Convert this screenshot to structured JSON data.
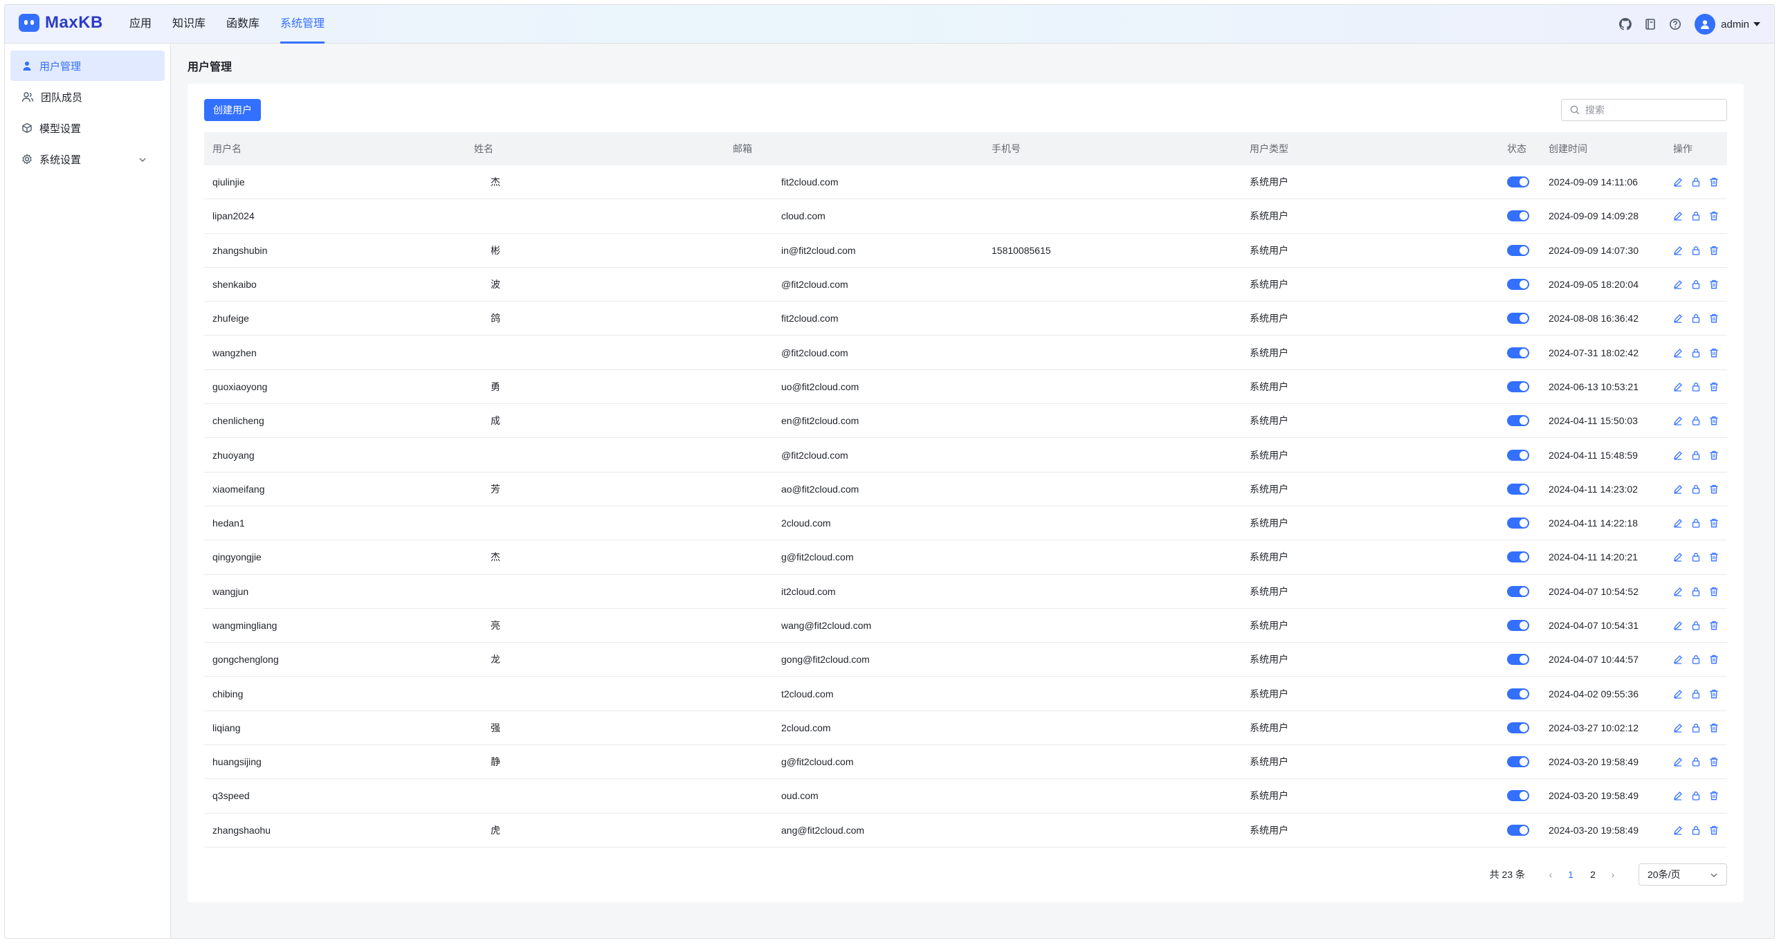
{
  "app": {
    "name": "MaxKB",
    "nav": [
      {
        "label": "应用",
        "active": false
      },
      {
        "label": "知识库",
        "active": false
      },
      {
        "label": "函数库",
        "active": false
      },
      {
        "label": "系统管理",
        "active": true
      }
    ],
    "user": "admin",
    "header_icons": [
      "github-icon",
      "book-icon",
      "help-icon"
    ]
  },
  "sidebar": {
    "items": [
      {
        "label": "用户管理",
        "icon": "user-icon",
        "active": true
      },
      {
        "label": "团队成员",
        "icon": "team-icon",
        "active": false
      },
      {
        "label": "模型设置",
        "icon": "cube-icon",
        "active": false
      },
      {
        "label": "系统设置",
        "icon": "gear-icon",
        "active": false,
        "expandable": true
      }
    ]
  },
  "page": {
    "title": "用户管理",
    "create_button": "创建用户",
    "search_placeholder": "搜索"
  },
  "table": {
    "columns": [
      "用户名",
      "姓名",
      "邮箱",
      "手机号",
      "用户类型",
      "状态",
      "创建时间",
      "操作"
    ],
    "rows": [
      {
        "username": "qiulinjie",
        "name": "杰",
        "email": "fit2cloud.com",
        "phone": "",
        "type": "系统用户",
        "enabled": true,
        "created": "2024-09-09 14:11:06"
      },
      {
        "username": "lipan2024",
        "name": "",
        "email": "cloud.com",
        "phone": "",
        "type": "系统用户",
        "enabled": true,
        "created": "2024-09-09 14:09:28"
      },
      {
        "username": "zhangshubin",
        "name": "彬",
        "email": "in@fit2cloud.com",
        "phone": "15810085615",
        "type": "系统用户",
        "enabled": true,
        "created": "2024-09-09 14:07:30"
      },
      {
        "username": "shenkaibo",
        "name": "波",
        "email": "@fit2cloud.com",
        "phone": "",
        "type": "系统用户",
        "enabled": true,
        "created": "2024-09-05 18:20:04"
      },
      {
        "username": "zhufeige",
        "name": "鸽",
        "email": "fit2cloud.com",
        "phone": "",
        "type": "系统用户",
        "enabled": true,
        "created": "2024-08-08 16:36:42"
      },
      {
        "username": "wangzhen",
        "name": "",
        "email": "@fit2cloud.com",
        "phone": "",
        "type": "系统用户",
        "enabled": true,
        "created": "2024-07-31 18:02:42"
      },
      {
        "username": "guoxiaoyong",
        "name": "勇",
        "email": "uo@fit2cloud.com",
        "phone": "",
        "type": "系统用户",
        "enabled": true,
        "created": "2024-06-13 10:53:21"
      },
      {
        "username": "chenlicheng",
        "name": "成",
        "email": "en@fit2cloud.com",
        "phone": "",
        "type": "系统用户",
        "enabled": true,
        "created": "2024-04-11 15:50:03"
      },
      {
        "username": "zhuoyang",
        "name": "",
        "email": "@fit2cloud.com",
        "phone": "",
        "type": "系统用户",
        "enabled": true,
        "created": "2024-04-11 15:48:59"
      },
      {
        "username": "xiaomeifang",
        "name": "芳",
        "email": "ao@fit2cloud.com",
        "phone": "",
        "type": "系统用户",
        "enabled": true,
        "created": "2024-04-11 14:23:02"
      },
      {
        "username": "hedan1",
        "name": "",
        "email": "2cloud.com",
        "phone": "",
        "type": "系统用户",
        "enabled": true,
        "created": "2024-04-11 14:22:18"
      },
      {
        "username": "qingyongjie",
        "name": "杰",
        "email": "g@fit2cloud.com",
        "phone": "",
        "type": "系统用户",
        "enabled": true,
        "created": "2024-04-11 14:20:21"
      },
      {
        "username": "wangjun",
        "name": "",
        "email": "it2cloud.com",
        "phone": "",
        "type": "系统用户",
        "enabled": true,
        "created": "2024-04-07 10:54:52"
      },
      {
        "username": "wangmingliang",
        "name": "亮",
        "email": "wang@fit2cloud.com",
        "phone": "",
        "type": "系统用户",
        "enabled": true,
        "created": "2024-04-07 10:54:31"
      },
      {
        "username": "gongchenglong",
        "name": "龙",
        "email": "gong@fit2cloud.com",
        "phone": "",
        "type": "系统用户",
        "enabled": true,
        "created": "2024-04-07 10:44:57"
      },
      {
        "username": "chibing",
        "name": "",
        "email": "t2cloud.com",
        "phone": "",
        "type": "系统用户",
        "enabled": true,
        "created": "2024-04-02 09:55:36"
      },
      {
        "username": "liqiang",
        "name": "强",
        "email": "2cloud.com",
        "phone": "",
        "type": "系统用户",
        "enabled": true,
        "created": "2024-03-27 10:02:12"
      },
      {
        "username": "huangsijing",
        "name": "静",
        "email": "g@fit2cloud.com",
        "phone": "",
        "type": "系统用户",
        "enabled": true,
        "created": "2024-03-20 19:58:49"
      },
      {
        "username": "q3speed",
        "name": "",
        "email": "oud.com",
        "phone": "",
        "type": "系统用户",
        "enabled": true,
        "created": "2024-03-20 19:58:49"
      },
      {
        "username": "zhangshaohu",
        "name": "虎",
        "email": "ang@fit2cloud.com",
        "phone": "",
        "type": "系统用户",
        "enabled": true,
        "created": "2024-03-20 19:58:49"
      }
    ]
  },
  "pagination": {
    "total": "共 23 条",
    "pages": [
      "1",
      "2"
    ],
    "current": "1",
    "page_size": "20条/页"
  },
  "colors": {
    "accent": "#3370ff",
    "logo_text": "#2a3cc7"
  }
}
